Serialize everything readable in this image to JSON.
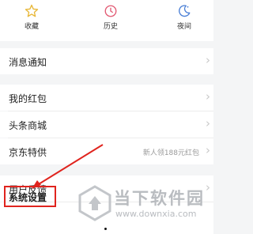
{
  "top_nav": {
    "favorites_label": "收藏",
    "history_label": "历史",
    "night_label": "夜间"
  },
  "menu": {
    "notifications_label": "消息通知",
    "my_red_packets_label": "我的红包",
    "toutiao_mall_label": "头条商城",
    "jd_specials_label": "京东特供",
    "jd_specials_extra": "新人领188元红包",
    "feedback_label": "用户反馈",
    "system_settings_label": "系统设置"
  },
  "colors": {
    "favorites_icon": "#e8b83a",
    "history_icon": "#e25a73",
    "night_icon": "#4a7fd6",
    "annotation_red": "#e0241e",
    "watermark_grey": "#b9bcc0"
  },
  "watermark": {
    "title": "当下软件园",
    "url": "www.downxia.com"
  }
}
